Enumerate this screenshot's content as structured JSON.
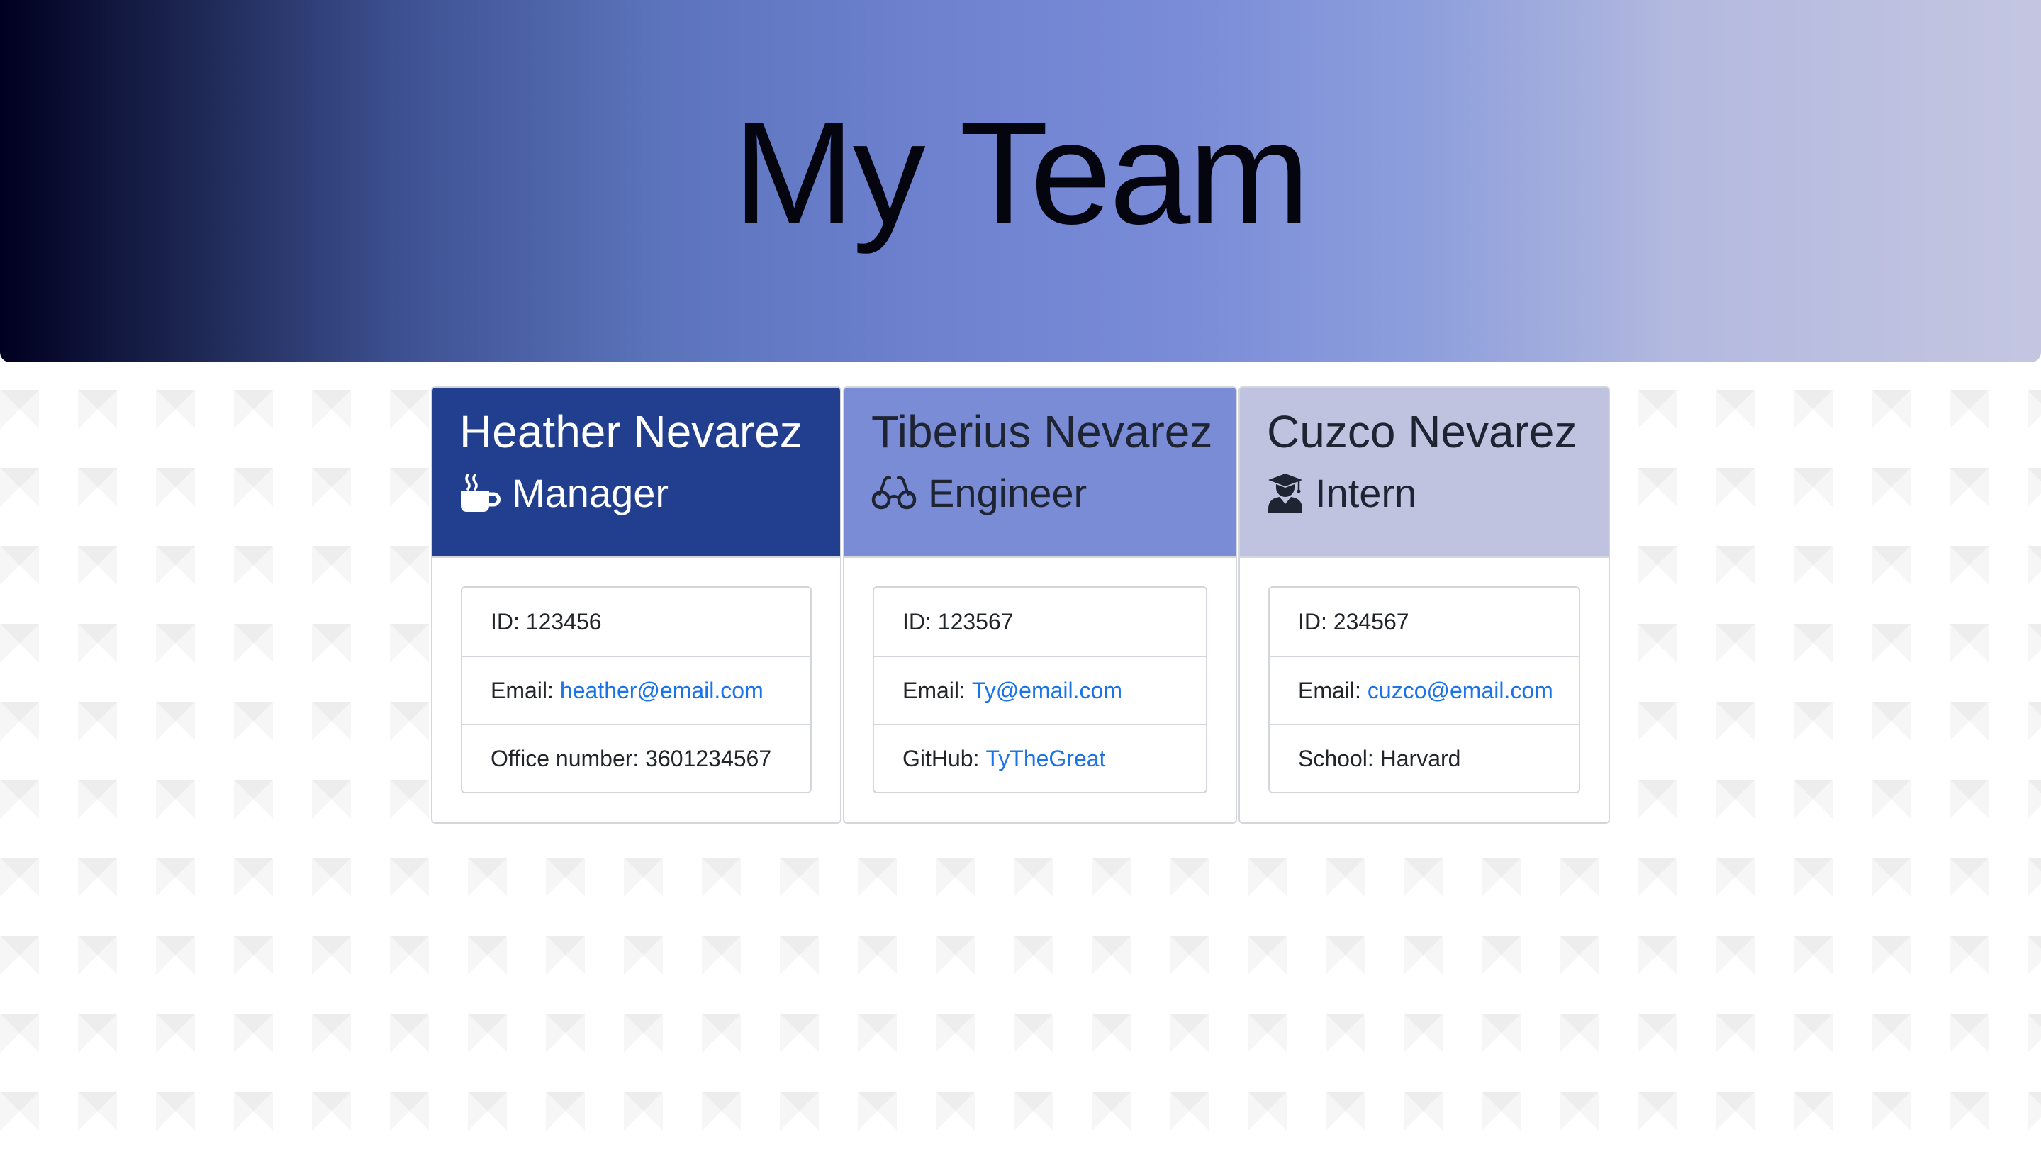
{
  "header": {
    "title": "My Team"
  },
  "colors": {
    "manager_header": "#213f8e",
    "engineer_header": "#7b8cd7",
    "intern_header": "#c0c3df",
    "link": "#1a73e8"
  },
  "cards": [
    {
      "name": "Heather Nevarez",
      "role": "Manager",
      "icon": "coffee-mug-icon",
      "id_label": "ID:",
      "id_value": "123456",
      "email_label": "Email:",
      "email": "heather@email.com",
      "extra_label": "Office number:",
      "extra_value": "3601234567"
    },
    {
      "name": "Tiberius Nevarez",
      "role": "Engineer",
      "icon": "glasses-icon",
      "id_label": "ID:",
      "id_value": "123567",
      "email_label": "Email:",
      "email": "Ty@email.com",
      "extra_label": "GitHub:",
      "extra_value": "TyTheGreat"
    },
    {
      "name": "Cuzco Nevarez",
      "role": "Intern",
      "icon": "graduate-icon",
      "id_label": "ID:",
      "id_value": "234567",
      "email_label": "Email:",
      "email": "cuzco@email.com",
      "extra_label": "School:",
      "extra_value": "Harvard"
    }
  ]
}
